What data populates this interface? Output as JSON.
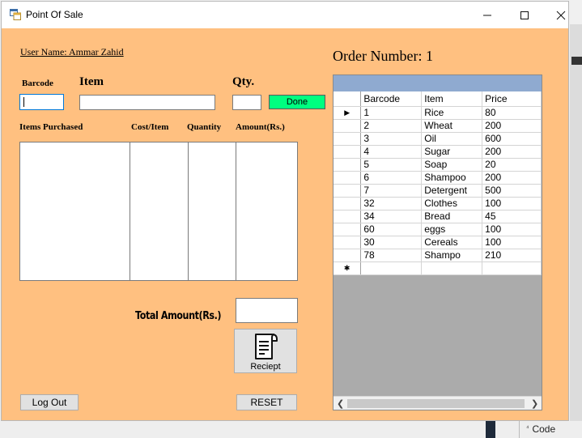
{
  "window": {
    "title": "Point Of Sale"
  },
  "form": {
    "user_name": "User Name: Ammar Zahid",
    "order_number": "Order Number: 1",
    "barcode_label": "Barcode",
    "item_label": "Item",
    "qty_label": "Qty.",
    "barcode_value": "",
    "item_value": "",
    "qty_value": "",
    "done_label": "Done",
    "headers": {
      "items": "Items Purchased",
      "cost": "Cost/Item",
      "quantity": "Quantity",
      "amount": "Amount(Rs.)"
    },
    "total_label": "Total Amount(Rs.)",
    "total_value": "",
    "receipt_label": "Reciept",
    "logout_label": "Log Out",
    "reset_label": "RESET"
  },
  "grid": {
    "columns": [
      "Barcode",
      "Item",
      "Price"
    ],
    "rows": [
      [
        "1",
        "Rice",
        "80"
      ],
      [
        "2",
        "Wheat",
        "200"
      ],
      [
        "3",
        "Oil",
        "600"
      ],
      [
        "4",
        "Sugar",
        "200"
      ],
      [
        "5",
        "Soap",
        "20"
      ],
      [
        "6",
        "Shampoo",
        "200"
      ],
      [
        "7",
        "Detergent",
        "500"
      ],
      [
        "32",
        "Clothes",
        "100"
      ],
      [
        "34",
        "Bread",
        "45"
      ],
      [
        "60",
        "eggs",
        "100"
      ],
      [
        "30",
        "Cereals",
        "100"
      ],
      [
        "78",
        "Shampo",
        "210"
      ]
    ]
  },
  "background": {
    "code_tab": "Code"
  },
  "colors": {
    "form_bg": "#ffc080",
    "done_button": "#00ff80",
    "grid_header_band": "#8faad0"
  }
}
